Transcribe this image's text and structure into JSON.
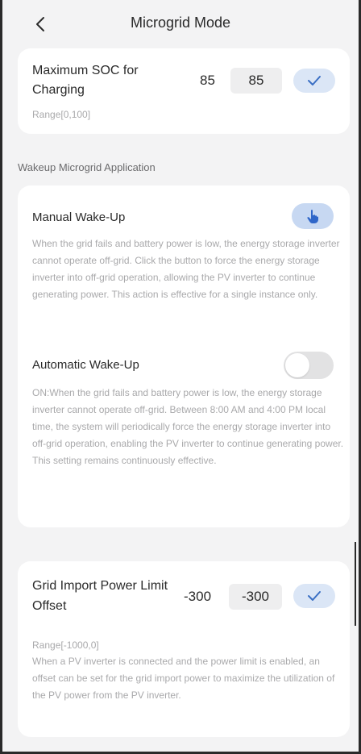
{
  "header": {
    "title": "Microgrid Mode",
    "back_icon": "chevron-left-icon"
  },
  "soc": {
    "label": "Maximum SOC for Charging",
    "range": "Range[0,100]",
    "current_value": "85",
    "input_value": "85",
    "confirm_icon": "check-icon"
  },
  "wakeup": {
    "section_label": "Wakeup Microgrid Application",
    "manual": {
      "label": "Manual Wake-Up",
      "description": "When the grid fails and battery power is low, the energy storage inverter cannot operate off-grid. Click the button to force the energy storage inverter into off-grid operation, allowing the PV inverter to continue generating power. This action is effective for a single instance only.",
      "button_icon": "tap-hand-icon"
    },
    "automatic": {
      "label": "Automatic Wake-Up",
      "enabled": false,
      "description": "ON:When the grid fails and battery power is low, the energy storage inverter cannot operate off-grid. Between 8:00 AM and 4:00 PM local time, the system will periodically force the energy storage inverter into off-grid operation, enabling the PV inverter to continue generating power. This setting remains continuously effective."
    }
  },
  "grid_import": {
    "label": "Grid Import Power Limit Offset",
    "current_value": "-300",
    "input_value": "-300",
    "range": "Range[-1000,0]",
    "description": "When a PV inverter is connected and the power limit is enabled, an offset can be set for the grid import power to maximize the utilization of the PV power from the PV inverter.",
    "confirm_icon": "check-icon"
  },
  "colors": {
    "background": "#f3f3f4",
    "card": "#ffffff",
    "accent": "#3a6fc4",
    "confirm_bg": "#dbe6f6",
    "toggle_off": "#e2e2e3",
    "hint_text": "#a9a9ab"
  }
}
